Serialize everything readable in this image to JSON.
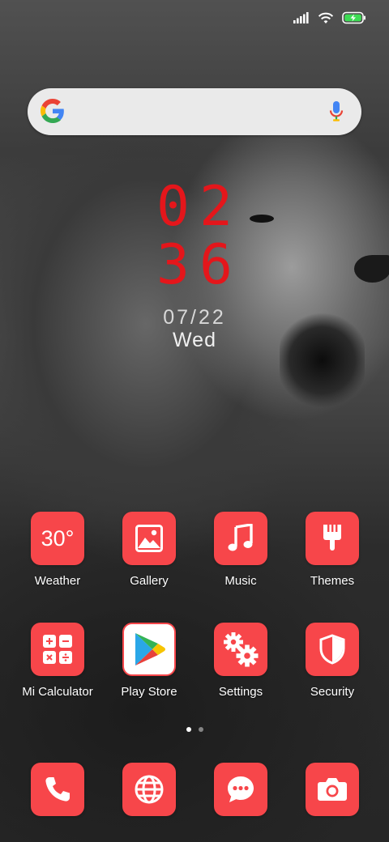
{
  "status_bar": {
    "icons": [
      "signal-icon",
      "wifi-icon",
      "battery-charging-icon"
    ],
    "battery_color": "#3ddc54"
  },
  "search": {
    "logo": "google-logo-icon",
    "mic": "mic-icon"
  },
  "clock": {
    "hours": "02",
    "minutes": "36",
    "date": "07/22",
    "weekday": "Wed",
    "color": "#e4161b"
  },
  "apps": [
    {
      "label": "Weather",
      "icon": "weather-icon",
      "temp": "30°"
    },
    {
      "label": "Gallery",
      "icon": "gallery-icon"
    },
    {
      "label": "Music",
      "icon": "music-note-icon"
    },
    {
      "label": "Themes",
      "icon": "paintbrush-icon"
    },
    {
      "label": "Mi Calculator",
      "icon": "calculator-icon"
    },
    {
      "label": "Play Store",
      "icon": "play-store-icon"
    },
    {
      "label": "Settings",
      "icon": "gears-icon"
    },
    {
      "label": "Security",
      "icon": "shield-icon"
    }
  ],
  "page_indicator": {
    "pages": 2,
    "active": 1
  },
  "dock": [
    {
      "icon": "phone-icon"
    },
    {
      "icon": "globe-icon"
    },
    {
      "icon": "message-icon"
    },
    {
      "icon": "camera-icon"
    }
  ],
  "accent_color": "#f7464a"
}
